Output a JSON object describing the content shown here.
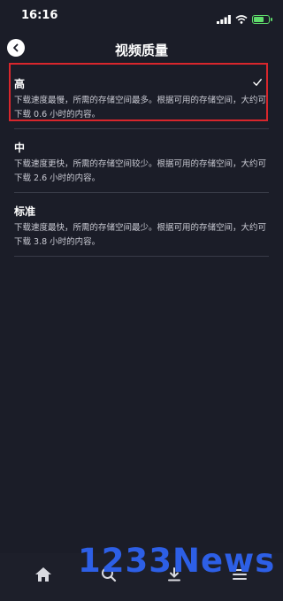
{
  "status_bar": {
    "time": "16:16"
  },
  "header": {
    "title": "视频质量"
  },
  "options": [
    {
      "title": "高",
      "description": "下载速度最慢，所需的存储空间最多。根据可用的存储空间，大约可下载 0.6 小时的内容。",
      "selected": true
    },
    {
      "title": "中",
      "description": "下载速度更快，所需的存储空间较少。根据可用的存储空间，大约可下载 2.6 小时的内容。",
      "selected": false
    },
    {
      "title": "标准",
      "description": "下载速度最快，所需的存储空间最少。根据可用的存储空间，大约可下载 3.8 小时的内容。",
      "selected": false
    }
  ],
  "tab_bar": {
    "icons": [
      "home-icon",
      "search-icon",
      "download-icon",
      "menu-icon"
    ]
  },
  "watermark": {
    "text": "1233News"
  },
  "colors": {
    "background": "#1b1d28",
    "highlight": "#d8262c",
    "watermark": "#2d5fe6",
    "battery": "#5fdc6b"
  }
}
